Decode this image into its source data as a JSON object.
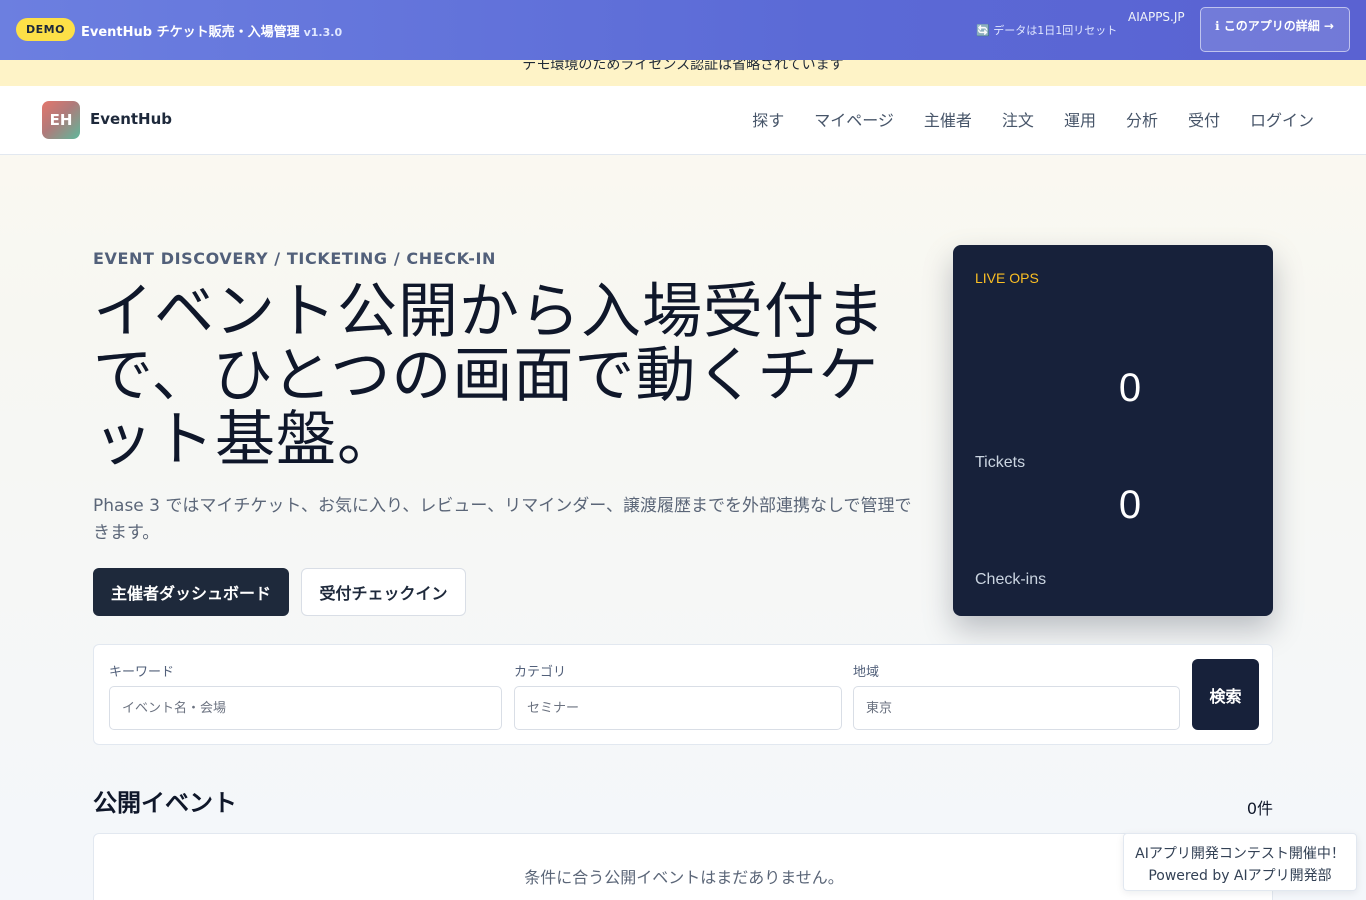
{
  "demo_bar": {
    "badge": "DEMO",
    "title": "EventHub チケット販売・入場管理",
    "version": "v1.3.0",
    "reset_notice": "🔄 データは1日1回リセット",
    "site": "AIAPPS.JP",
    "detail_button": "ℹ このアプリの詳細 →"
  },
  "license_notice": "デモ環境のためライセンス認証は省略されています",
  "header": {
    "logo_mark": "EH",
    "logo_text": "EventHub",
    "nav": [
      "探す",
      "マイページ",
      "主催者",
      "注文",
      "運用",
      "分析",
      "受付",
      "ログイン"
    ]
  },
  "hero": {
    "eyebrow": "EVENT DISCOVERY / TICKETING / CHECK-IN",
    "title": "イベント公開から入場受付まで、ひとつの画面で動くチケット基盤。",
    "description": "Phase 3 ではマイチケット、お気に入り、レビュー、リマインダー、譲渡履歴までを外部連携なしで管理できます。",
    "primary_button": "主催者ダッシュボード",
    "secondary_button": "受付チェックイン"
  },
  "live_ops": {
    "label": "LIVE OPS",
    "tickets_value": "0",
    "tickets_label": "Tickets",
    "checkins_value": "0",
    "checkins_label": "Check-ins"
  },
  "search": {
    "keyword_label": "キーワード",
    "keyword_placeholder": "イベント名・会場",
    "category_label": "カテゴリ",
    "category_placeholder": "セミナー",
    "region_label": "地域",
    "region_placeholder": "東京",
    "submit": "検索"
  },
  "events": {
    "title": "公開イベント",
    "count": "0件",
    "empty": "条件に合う公開イベントはまだありません。"
  },
  "contest": {
    "line1": "AIアプリ開発コンテスト開催中！",
    "line2": "Powered by AIアプリ開発部"
  },
  "colors": {
    "demo_bar": "#5b6ad6",
    "demo_badge": "#fde047",
    "license_strip": "#fef3c7",
    "primary": "#1e293b",
    "live_card": "#17213a",
    "live_label": "#fbbf24"
  }
}
